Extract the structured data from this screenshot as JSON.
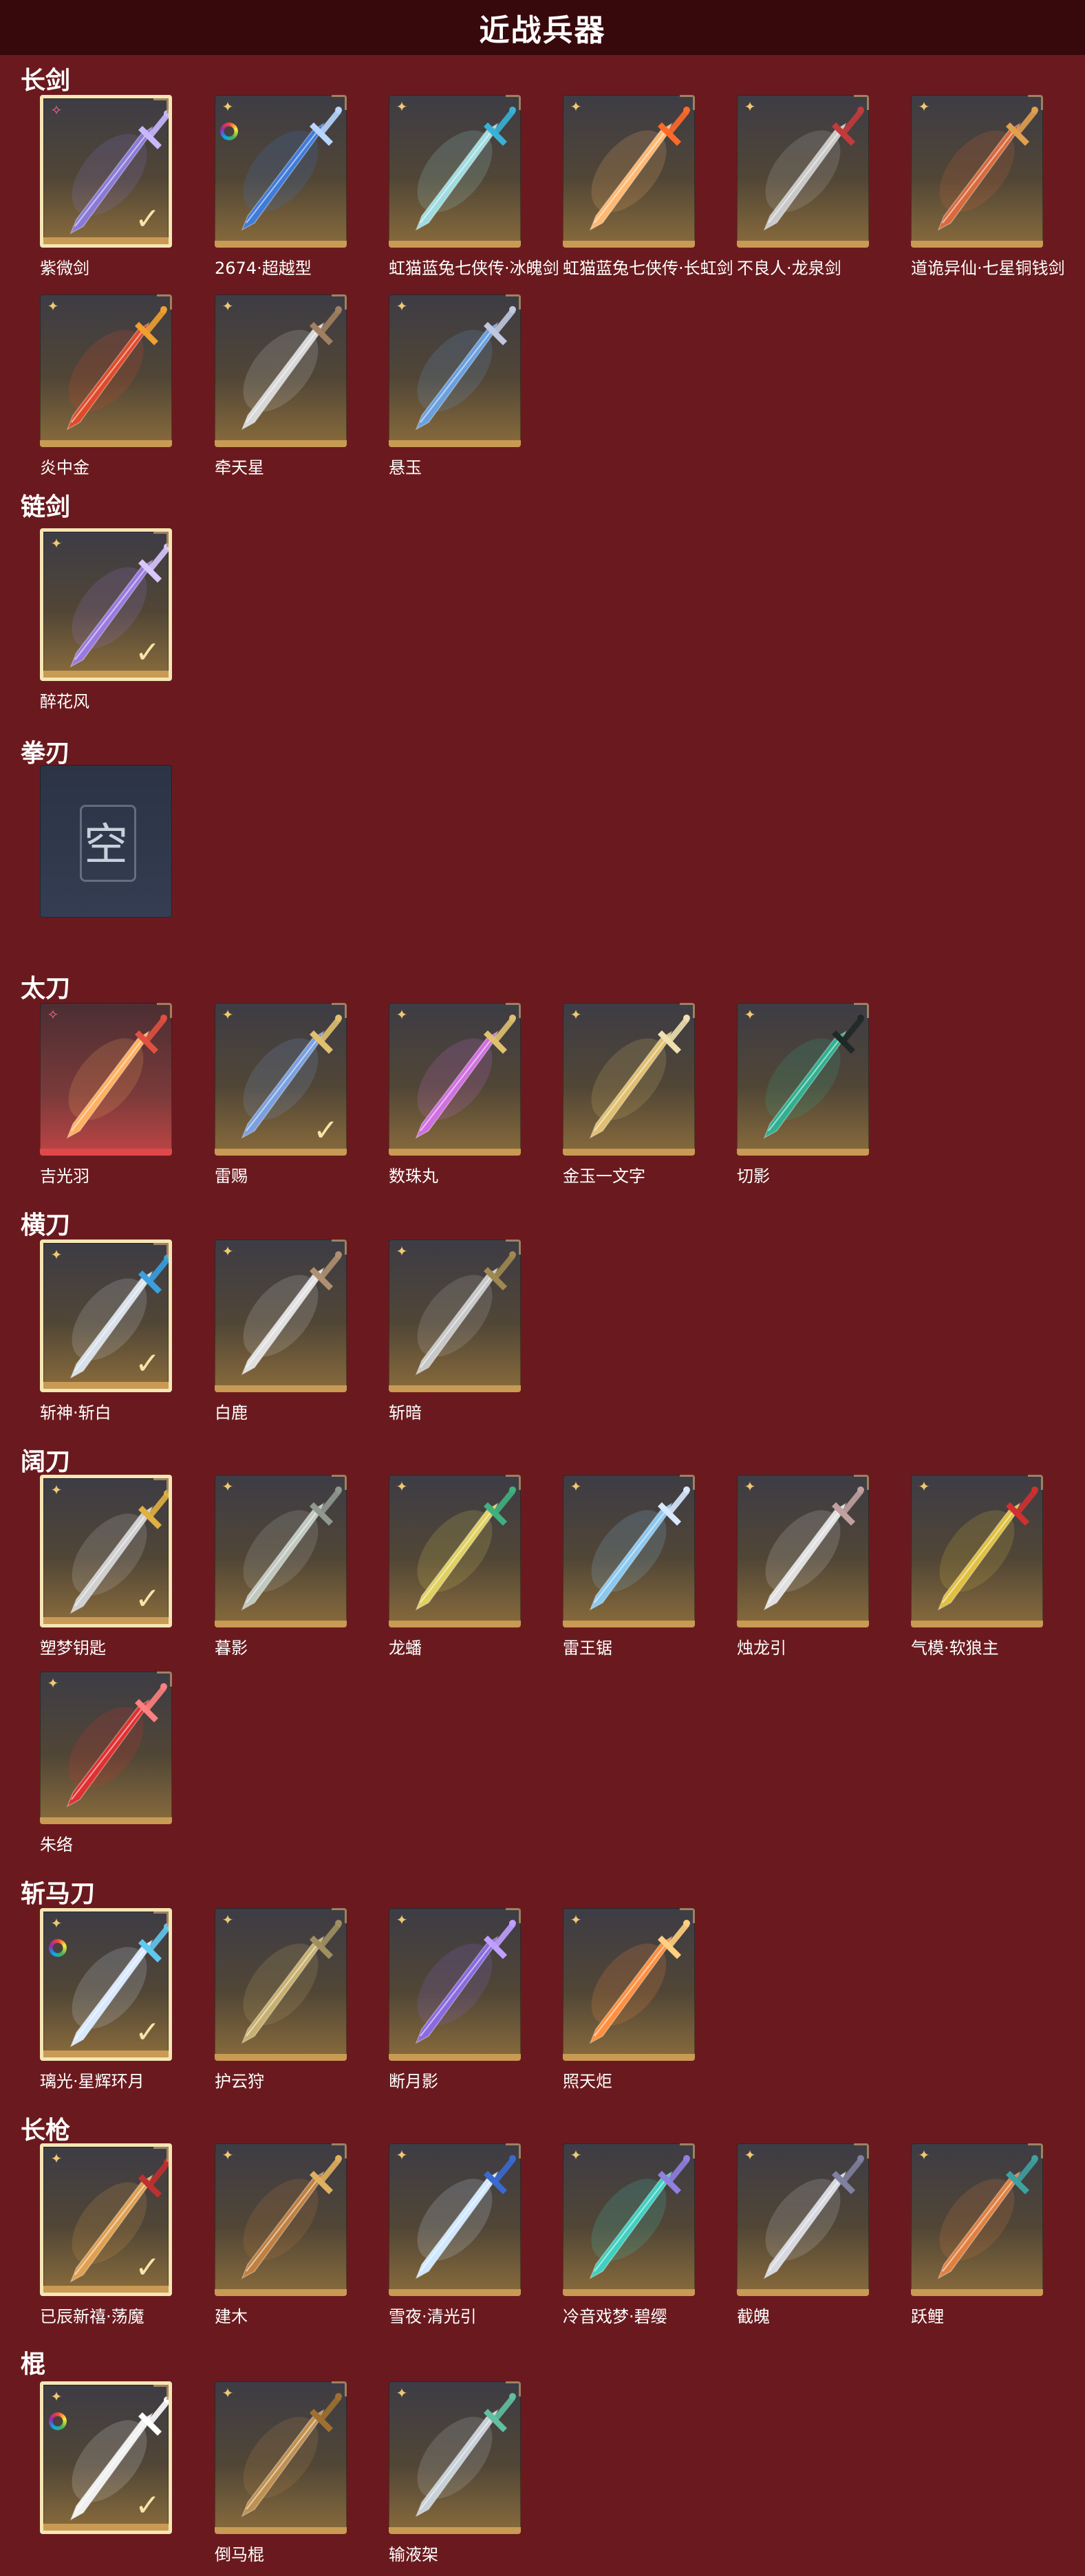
{
  "page_title": "近战兵器",
  "sections": [
    {
      "title": "长剑",
      "items": [
        {
          "name": "紫微剑",
          "selected": true,
          "owned": true,
          "badge": "red-star",
          "style": "gold",
          "blade": "#8a7ad8",
          "hilt": "#c9b8ff"
        },
        {
          "name": "2674·超越型",
          "badge": "ring",
          "style": "gold",
          "blade": "#3f7bd9",
          "hilt": "#b8d6ff"
        },
        {
          "name": "虹猫蓝兔七侠传·冰魄剑",
          "badge": "star",
          "style": "gold",
          "blade": "#9fdce0",
          "hilt": "#3ab0d6"
        },
        {
          "name": "虹猫蓝兔七侠传·长虹剑",
          "badge": "star",
          "style": "gold",
          "blade": "#ffb870",
          "hilt": "#ff6a2a"
        },
        {
          "name": "不良人·龙泉剑",
          "badge": "star",
          "style": "gold",
          "blade": "#c9c9c9",
          "hilt": "#c23b3b"
        },
        {
          "name": "道诡异仙·七星铜钱剑",
          "badge": "star",
          "style": "gold",
          "blade": "#d86a3c",
          "hilt": "#e0a050"
        },
        {
          "name": "炎中金",
          "badge": "star",
          "style": "gold",
          "blade": "#e04a2a",
          "hilt": "#f0a030"
        },
        {
          "name": "牵天星",
          "badge": "star",
          "style": "gold",
          "blade": "#d8d8d8",
          "hilt": "#a08060"
        },
        {
          "name": "悬玉",
          "badge": "star",
          "style": "gold",
          "blade": "#6aa0e0",
          "hilt": "#c0c8e0"
        }
      ]
    },
    {
      "title": "链剑",
      "items": [
        {
          "name": "醉花风",
          "selected": true,
          "owned": true,
          "badge": "star",
          "style": "gold",
          "blade": "#9a7ae0",
          "hilt": "#d9c6ff"
        }
      ]
    },
    {
      "title": "拳刃",
      "items": [
        {
          "name": "",
          "empty": true,
          "glyph": "空",
          "style": "blue"
        }
      ]
    },
    {
      "title": "太刀",
      "items": [
        {
          "name": "吉光羽",
          "badge": "red-star",
          "style": "red",
          "blade": "#ffb060",
          "hilt": "#e05040"
        },
        {
          "name": "雷赐",
          "owned": true,
          "badge": "star",
          "style": "gold",
          "blade": "#7aa0e0",
          "hilt": "#e0c070"
        },
        {
          "name": "数珠丸",
          "badge": "star",
          "style": "gold",
          "blade": "#d070e0",
          "hilt": "#e0c070"
        },
        {
          "name": "金玉一文字",
          "badge": "star",
          "style": "gold",
          "blade": "#e0c070",
          "hilt": "#f0e0b0"
        },
        {
          "name": "切影",
          "badge": "star",
          "style": "gold",
          "blade": "#30b090",
          "hilt": "#202828"
        }
      ]
    },
    {
      "title": "横刀",
      "items": [
        {
          "name": "斩神·斩白",
          "selected": true,
          "owned": true,
          "badge": "star",
          "style": "gold",
          "blade": "#d8e0ea",
          "hilt": "#3aa0e0"
        },
        {
          "name": "白鹿",
          "badge": "star",
          "style": "gold",
          "blade": "#e0e0e0",
          "hilt": "#b09070"
        },
        {
          "name": "斩暗",
          "badge": "star",
          "style": "gold",
          "blade": "#c8c8c8",
          "hilt": "#a08850"
        }
      ]
    },
    {
      "title": "阔刀",
      "items": [
        {
          "name": "塑梦钥匙",
          "selected": true,
          "owned": true,
          "badge": "star",
          "style": "gold",
          "blade": "#d0d0d0",
          "hilt": "#e0b040"
        },
        {
          "name": "暮影",
          "badge": "star",
          "style": "gold",
          "blade": "#c0c8c0",
          "hilt": "#909890"
        },
        {
          "name": "龙蟠",
          "badge": "star",
          "style": "gold",
          "blade": "#e0d060",
          "hilt": "#40b080"
        },
        {
          "name": "雷王锯",
          "badge": "star",
          "style": "gold",
          "blade": "#8ac8f0",
          "hilt": "#d8e8ff"
        },
        {
          "name": "烛龙引",
          "badge": "star",
          "style": "gold",
          "blade": "#e0e0e0",
          "hilt": "#c0a0a0"
        },
        {
          "name": "气模·软狼主",
          "badge": "star",
          "style": "gold",
          "blade": "#e0c040",
          "hilt": "#d03030"
        },
        {
          "name": "朱络",
          "badge": "star",
          "style": "gold",
          "blade": "#e03030",
          "hilt": "#ff8080"
        }
      ]
    },
    {
      "title": "斩马刀",
      "items": [
        {
          "name": "璃光·星辉环月",
          "selected": true,
          "owned": true,
          "badge": "ring",
          "style": "gold",
          "blade": "#d8e8ff",
          "hilt": "#60c8f0"
        },
        {
          "name": "护云狩",
          "badge": "star",
          "style": "gold",
          "blade": "#c8b070",
          "hilt": "#a09060"
        },
        {
          "name": "断月影",
          "badge": "star",
          "style": "gold",
          "blade": "#8a6ae0",
          "hilt": "#c0a0ff"
        },
        {
          "name": "照天炬",
          "badge": "star",
          "style": "gold",
          "blade": "#ff9040",
          "hilt": "#ffd080"
        }
      ]
    },
    {
      "title": "长枪",
      "items": [
        {
          "name": "已辰新禧·荡魔",
          "selected": true,
          "owned": true,
          "badge": "star",
          "style": "gold",
          "blade": "#e0a050",
          "hilt": "#c03030"
        },
        {
          "name": "建木",
          "badge": "star",
          "style": "gold",
          "blade": "#c08040",
          "hilt": "#e0b060"
        },
        {
          "name": "雪夜·清光引",
          "badge": "star",
          "style": "gold",
          "blade": "#d0e8ff",
          "hilt": "#3a6ad0"
        },
        {
          "name": "冷音戏梦·碧缨",
          "badge": "star",
          "style": "gold",
          "blade": "#40d0c0",
          "hilt": "#9080e0"
        },
        {
          "name": "截魄",
          "badge": "star",
          "style": "gold",
          "blade": "#d8d8e0",
          "hilt": "#8080a0"
        },
        {
          "name": "跃鲤",
          "badge": "star",
          "style": "gold",
          "blade": "#e08040",
          "hilt": "#40a0a0"
        }
      ]
    },
    {
      "title": "棍",
      "items": [
        {
          "name": "",
          "selected": true,
          "owned": true,
          "badge": "ring",
          "style": "gold",
          "blade": "#f0f0f0",
          "hilt": "#ffffff"
        },
        {
          "name": "倒马棍",
          "badge": "star",
          "style": "gold",
          "blade": "#c09050",
          "hilt": "#a07030"
        },
        {
          "name": "输液架",
          "badge": "star",
          "style": "gold",
          "blade": "#c8d0d8",
          "hilt": "#60c0a0"
        }
      ]
    }
  ]
}
